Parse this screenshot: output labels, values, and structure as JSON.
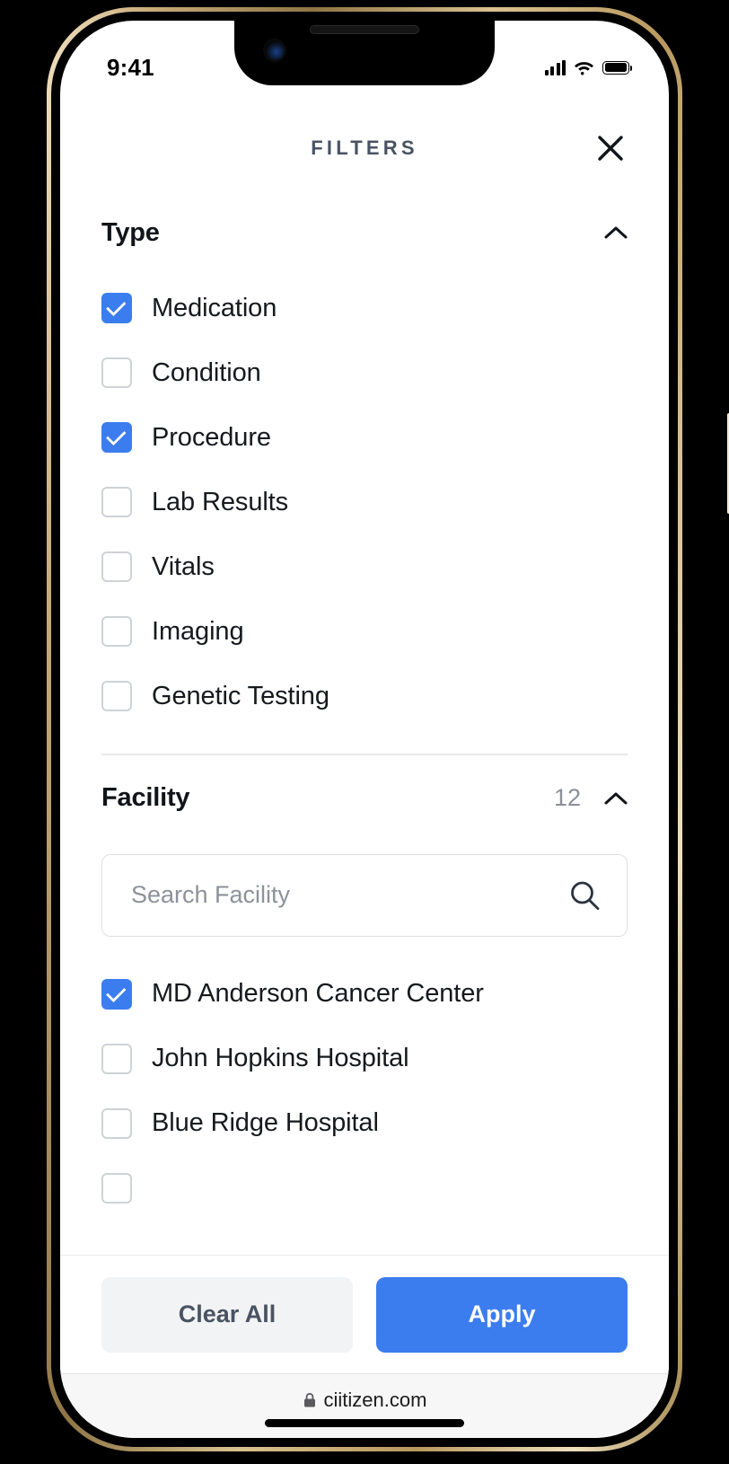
{
  "status_bar": {
    "time": "9:41",
    "icons": [
      "cellular-signal-icon",
      "wifi-icon",
      "battery-icon"
    ]
  },
  "header": {
    "title": "FILTERS",
    "close_icon": "close-icon"
  },
  "sections": [
    {
      "id": "type",
      "title": "Type",
      "count": "",
      "collapse_icon": "chevron-up-icon",
      "options": [
        {
          "label": "Medication",
          "checked": true
        },
        {
          "label": "Condition",
          "checked": false
        },
        {
          "label": "Procedure",
          "checked": true
        },
        {
          "label": "Lab Results",
          "checked": false
        },
        {
          "label": "Vitals",
          "checked": false
        },
        {
          "label": "Imaging",
          "checked": false
        },
        {
          "label": "Genetic Testing",
          "checked": false
        }
      ]
    },
    {
      "id": "facility",
      "title": "Facility",
      "count": "12",
      "collapse_icon": "chevron-up-icon",
      "search": {
        "placeholder": "Search Facility",
        "value": "",
        "icon": "search-icon"
      },
      "options": [
        {
          "label": "MD Anderson Cancer Center",
          "checked": true
        },
        {
          "label": "John Hopkins Hospital",
          "checked": false
        },
        {
          "label": "Blue Ridge Hospital",
          "checked": false
        },
        {
          "label": "",
          "checked": false
        }
      ]
    }
  ],
  "footer": {
    "clear_label": "Clear All",
    "apply_label": "Apply"
  },
  "browser_bar": {
    "lock_icon": "lock-icon",
    "url": "ciitizen.com"
  },
  "colors": {
    "accent": "#3B7DEE",
    "title_gray": "#4a5363",
    "text": "#16191d",
    "checkbox_border": "#cfd2d6",
    "divider": "#e8e9eb",
    "clear_bg": "#f2f3f4"
  }
}
